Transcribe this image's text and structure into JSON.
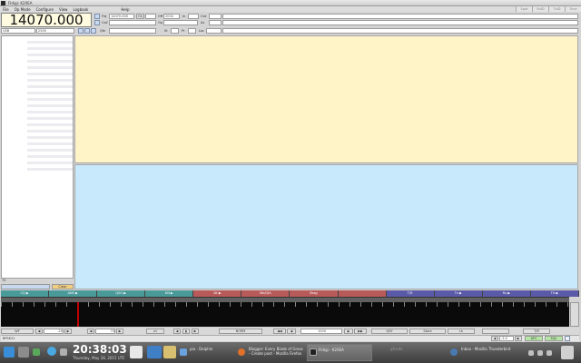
{
  "window": {
    "title": "Fldigi: K2XEA"
  },
  "menu": {
    "items": [
      "File",
      "Op Mode",
      "Configure",
      "View",
      "Logbook",
      "Help"
    ],
    "right_buttons": [
      "Spot",
      "RxID",
      "TxID",
      "Tune"
    ]
  },
  "frequency": {
    "display": "14070.000",
    "frq_label": "Frq",
    "frq_value": "14070.000",
    "on_label": "On",
    "off_label": "Off",
    "off_value": "2034",
    "in_label": "In",
    "out_label": "Out",
    "call_label": "Call",
    "op_label": "Op",
    "az_label": "Az",
    "qth_label": "Qth",
    "st_label": "St",
    "pr_label": "Pr",
    "loc_label": "Loc",
    "mode": "USB",
    "bw": "2500"
  },
  "left_panel": {
    "bottom_value": "70",
    "clear_label": "Clear"
  },
  "macros": [
    {
      "label": "CQ ▶",
      "color": "#4a9a9a"
    },
    {
      "label": "ANS ▶",
      "color": "#4a9a9a"
    },
    {
      "label": "QSO ▶",
      "color": "#4a9a9a"
    },
    {
      "label": "KN ▶",
      "color": "#4a9a9a"
    },
    {
      "label": "SK ▶",
      "color": "#b85a5a"
    },
    {
      "label": "Me/Qth",
      "color": "#b85a5a"
    },
    {
      "label": "Brag",
      "color": "#b85a5a"
    },
    {
      "label": "",
      "color": "#b85a5a"
    },
    {
      "label": "T/R",
      "color": "#5a5aa8"
    },
    {
      "label": "Tx ▶",
      "color": "#5a5aa8"
    },
    {
      "label": "Rx ▶",
      "color": "#5a5aa8"
    },
    {
      "label": "TX ▶",
      "color": "#5a5aa8"
    }
  ],
  "controls": {
    "wf_label": "WF",
    "wf_low": "-20",
    "wf_high": "70",
    "zoom": "x1",
    "norm": "NORM",
    "freq": "1000",
    "qsy": "QSY",
    "store": "Store",
    "lk": "Lk",
    "tr": "T/R"
  },
  "status": {
    "mode": "BPSK31",
    "afc_value": "-3.0",
    "afc_label": "AFC",
    "sql_label": "SQL"
  },
  "taskbar": {
    "time": "20:38:03",
    "date": "Thursday, May 28, 2015 UTC",
    "tasks": [
      "pia - Dolphin",
      "Blogger: Every Blade of Grass - Create post - Mozilla Firefox",
      "Fldigi - K2XEA",
      "gfcode",
      "Inbox - Mozilla Thunderbird"
    ]
  }
}
